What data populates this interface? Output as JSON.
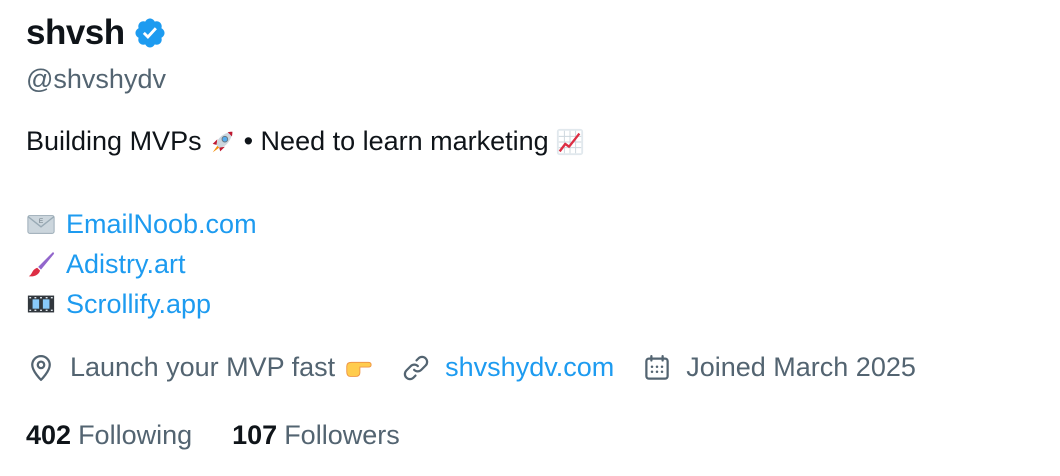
{
  "profile": {
    "display_name": "shvsh",
    "verified": true,
    "handle": "@shvshydv",
    "bio": {
      "part1": "Building MVPs",
      "part2": "• Need to learn marketing"
    },
    "links": [
      {
        "icon": "envelope-icon",
        "text": "EmailNoob.com"
      },
      {
        "icon": "paintbrush-icon",
        "text": "Adistry.art"
      },
      {
        "icon": "film-icon",
        "text": "Scrollify.app"
      }
    ],
    "location": "Launch your MVP fast",
    "website": "shvshydv.com",
    "joined": "Joined March 2025",
    "following_count": "402",
    "following_label": "Following",
    "followers_count": "107",
    "followers_label": "Followers"
  },
  "colors": {
    "accent": "#1d9bf0",
    "text_primary": "#0f1419",
    "text_secondary": "#536471"
  },
  "icons": [
    "verified-badge-icon",
    "rocket-icon",
    "chart-increasing-icon",
    "envelope-icon",
    "paintbrush-icon",
    "film-icon",
    "location-pin-icon",
    "pointing-right-icon",
    "link-icon",
    "calendar-icon"
  ]
}
